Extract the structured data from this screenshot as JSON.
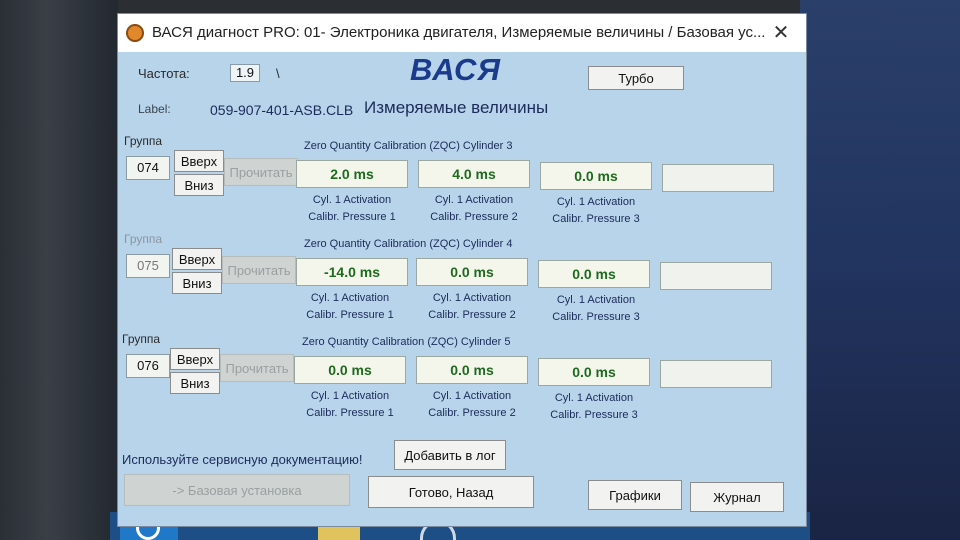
{
  "window": {
    "title": "ВАСЯ диагност PRO: 01- Электроника двигателя,  Измеряемые величины / Базовая ус...",
    "close": "✕"
  },
  "header": {
    "freq_label": "Частота:",
    "freq_value": "1.9",
    "freq_sep": "\\",
    "logo": "ВАСЯ",
    "turbo": "Турбо",
    "label_caption": "Label:",
    "label_value": "059-907-401-ASB.CLB",
    "mode_title": "Измеряемые величины"
  },
  "groups": [
    {
      "label": "Группа",
      "number": "074",
      "up": "Вверх",
      "down": "Вниз",
      "read": "Прочитать",
      "title": "Zero Quantity Calibration (ZQC) Cylinder 3",
      "values": [
        "2.0 ms",
        "4.0 ms",
        "0.0 ms",
        ""
      ],
      "descs": [
        [
          "Cyl. 1 Activation",
          "Calibr. Pressure 1"
        ],
        [
          "Cyl. 1 Activation",
          "Calibr. Pressure 2"
        ],
        [
          "Cyl. 1 Activation",
          "Calibr. Pressure 3"
        ]
      ]
    },
    {
      "label": "Группа",
      "number": "075",
      "up": "Вверх",
      "down": "Вниз",
      "read": "Прочитать",
      "title": "Zero Quantity Calibration (ZQC) Cylinder 4",
      "values": [
        "-14.0 ms",
        "0.0 ms",
        "0.0 ms",
        ""
      ],
      "descs": [
        [
          "Cyl. 1 Activation",
          "Calibr. Pressure 1"
        ],
        [
          "Cyl. 1 Activation",
          "Calibr. Pressure 2"
        ],
        [
          "Cyl. 1 Activation",
          "Calibr. Pressure 3"
        ]
      ]
    },
    {
      "label": "Группа",
      "number": "076",
      "up": "Вверх",
      "down": "Вниз",
      "read": "Прочитать",
      "title": "Zero Quantity Calibration (ZQC) Cylinder 5",
      "values": [
        "0.0 ms",
        "0.0 ms",
        "0.0 ms",
        ""
      ],
      "descs": [
        [
          "Cyl. 1 Activation",
          "Calibr. Pressure 1"
        ],
        [
          "Cyl. 1 Activation",
          "Calibr. Pressure 2"
        ],
        [
          "Cyl. 1 Activation",
          "Calibr. Pressure 3"
        ]
      ]
    }
  ],
  "footer": {
    "service_doc": "Используйте сервисную документацию!",
    "add_log": "Добавить в лог",
    "basic_setting": "-> Базовая установка",
    "done_back": "Готово, Назад",
    "graphs": "Графики",
    "journal": "Журнал"
  },
  "colors": {
    "window_bg": "#b8d4ea",
    "value_text": "#1e6b1e",
    "logo": "#1a3a8c"
  }
}
